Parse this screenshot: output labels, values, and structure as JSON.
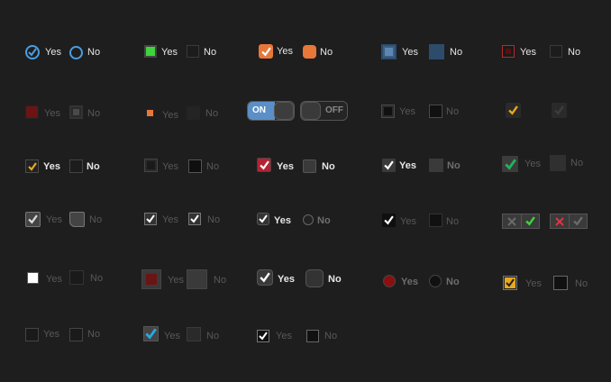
{
  "labels": {
    "r1": [
      "Yes",
      "No",
      "Yes",
      "No",
      "Yes",
      "No",
      "Yes",
      "No",
      "Yes",
      "No"
    ],
    "r2": [
      "Yes",
      "No",
      "Yes",
      "No",
      "ON",
      "OFF",
      "Yes",
      "No"
    ],
    "r3": [
      "Yes",
      "No",
      "Yes",
      "No",
      "Yes",
      "No",
      "Yes",
      "No",
      "Yes",
      "No"
    ],
    "r4": [
      "Yes",
      "No",
      "Yes",
      "No",
      "Yes",
      "No",
      "Yes",
      "No"
    ],
    "r5": [
      "Yes",
      "No",
      "Yes",
      "No",
      "Yes",
      "No",
      "Yes",
      "No",
      "Yes",
      "No"
    ],
    "r6": [
      "Yes",
      "No",
      "Yes",
      "No",
      "Yes",
      "No"
    ]
  },
  "colors": {
    "background": "#1e1e1e",
    "blue_accent": "#4a9de0",
    "green_accent": "#3dd43d",
    "orange_accent": "#e8773a",
    "dark_red": "#6a1414",
    "amber": "#e7a91c",
    "toggle_on": "#5b8fc7"
  },
  "icons": [
    "check-icon",
    "radio-ring-icon",
    "x-icon"
  ]
}
